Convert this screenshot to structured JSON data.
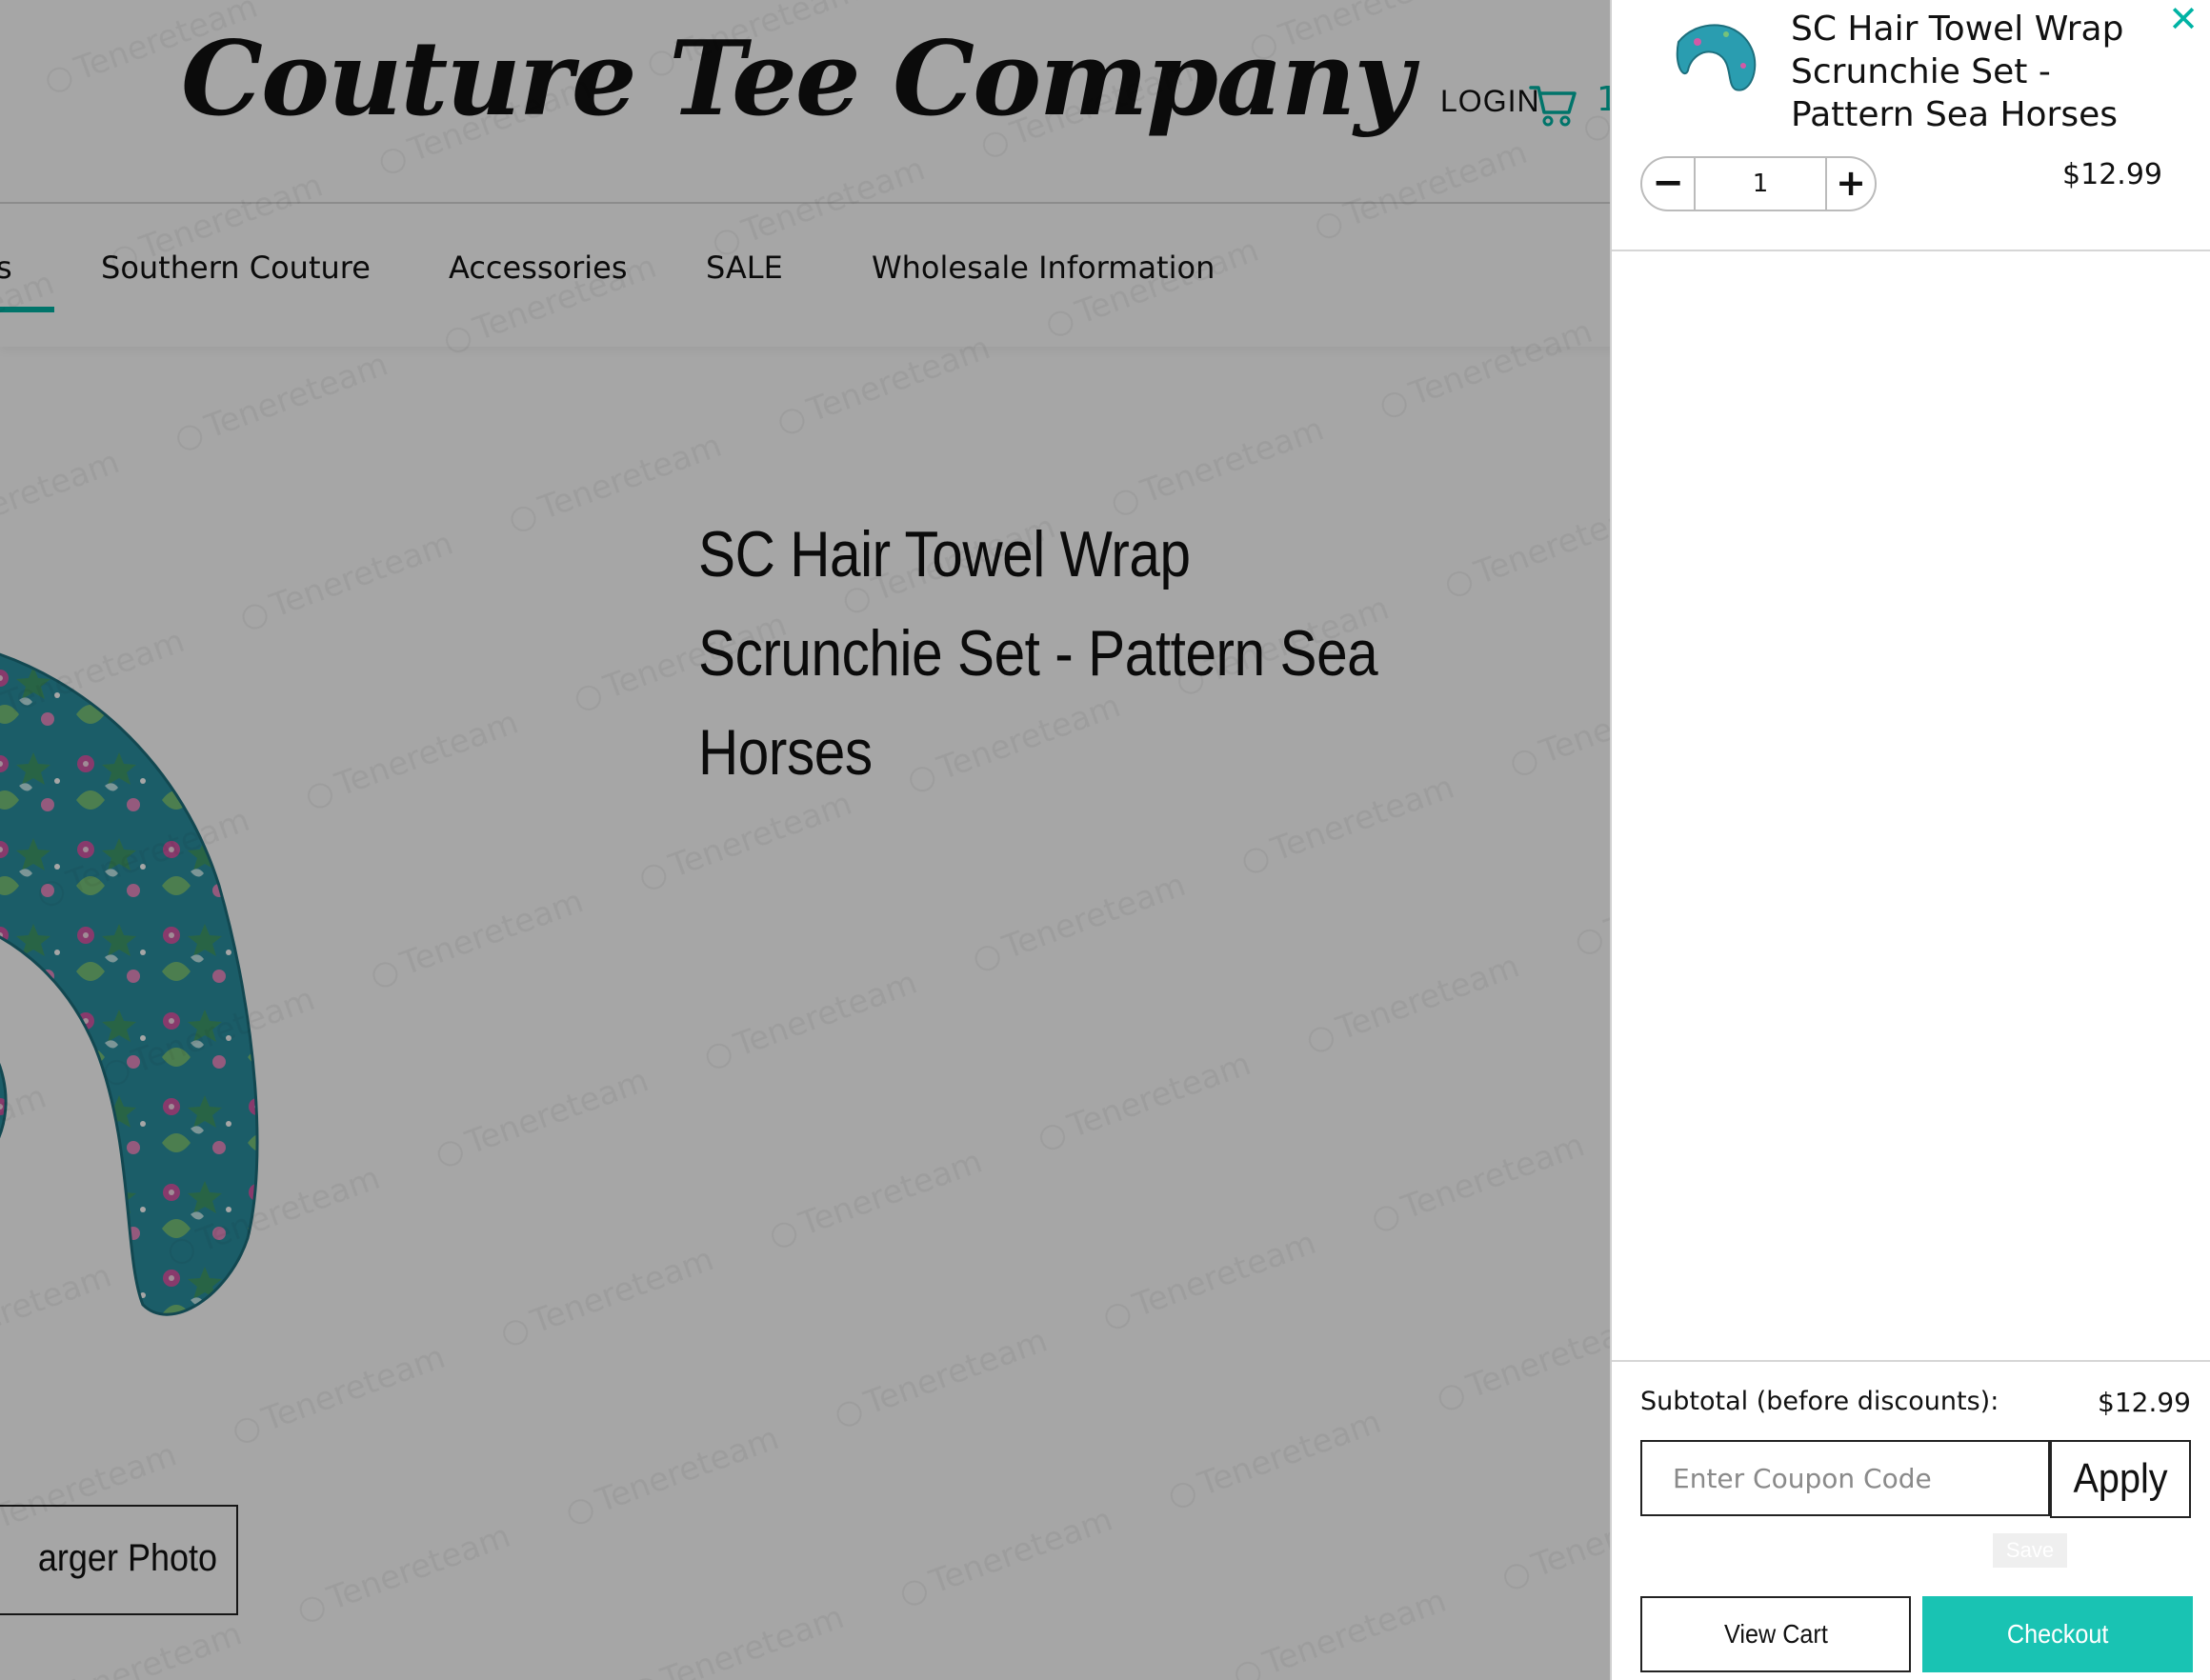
{
  "header": {
    "logo_text": "Couture Tee Company",
    "login_label": "LOGIN",
    "cart_count": "1"
  },
  "nav": {
    "partial_item": "s",
    "items": [
      {
        "label": "Southern Couture"
      },
      {
        "label": "Accessories"
      },
      {
        "label": "SALE"
      },
      {
        "label": "Wholesale Information"
      }
    ]
  },
  "product": {
    "title": "SC Hair Towel Wrap Scrunchie Set - Pattern Sea Horses",
    "view_larger_label": "arger Photo"
  },
  "cart_drawer": {
    "item": {
      "title": "SC Hair Towel Wrap Scrunchie Set - Pattern Sea Horses",
      "quantity": "1",
      "price": "$12.99"
    },
    "subtotal_label": "Subtotal (before discounts):",
    "subtotal_value": "$12.99",
    "coupon_placeholder": "Enter Coupon Code",
    "apply_label": "Apply",
    "save_tooltip": "Save",
    "view_cart_label": "View Cart",
    "checkout_label": "Checkout"
  },
  "watermark_text": "Tenereteam",
  "colors": {
    "accent": "#00b3a4",
    "checkout": "#19c3b3",
    "overlay": "rgba(0,0,0,0.35)",
    "product_teal": "#2a8fa0"
  },
  "icons": {
    "cart": "cart-icon",
    "close": "close-icon",
    "minus": "minus-icon",
    "plus": "plus-icon"
  }
}
